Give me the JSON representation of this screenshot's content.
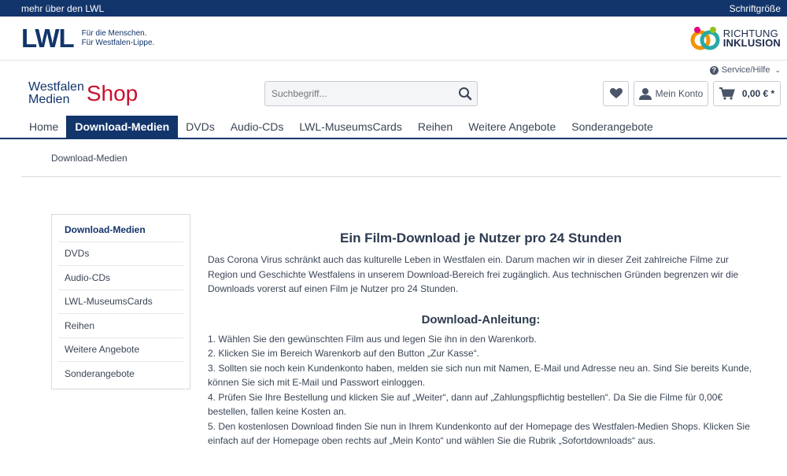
{
  "topbar": {
    "left_link": "mehr über den LWL",
    "font_size_label": "Schriftgröße"
  },
  "brand": {
    "lwl_mark": "LWL",
    "tagline_1": "Für die Menschen.",
    "tagline_2": "Für Westfalen-Lippe.",
    "inklusion_line_1": "RICHTUNG",
    "inklusion_line_2": "INKLUSION"
  },
  "service": {
    "label": "Service/Hilfe"
  },
  "shop": {
    "logo_line_1": "Westfalen",
    "logo_line_2": "Medien",
    "logo_shop": "Shop",
    "search_placeholder": "Suchbegriff...",
    "account_label": "Mein Konto",
    "cart_total": "0,00 € *"
  },
  "nav": {
    "items": [
      "Home",
      "Download-Medien",
      "DVDs",
      "Audio-CDs",
      "LWL-MuseumsCards",
      "Reihen",
      "Weitere Angebote",
      "Sonderangebote"
    ],
    "active": "Download-Medien"
  },
  "breadcrumb": {
    "current": "Download-Medien"
  },
  "sidebar": {
    "items": [
      "Download-Medien",
      "DVDs",
      "Audio-CDs",
      "LWL-MuseumsCards",
      "Reihen",
      "Weitere Angebote",
      "Sonderangebote"
    ]
  },
  "content": {
    "title": "Ein Film-Download je Nutzer pro 24 Stunden",
    "intro": " Das Corona Virus schränkt auch das kulturelle Leben in Westfalen ein. Darum machen wir in dieser Zeit zahlreiche Filme zur Region und Geschichte Westfalens in unserem Download-Bereich frei zugänglich. Aus technischen Gründen begrenzen wir die Downloads vorerst auf einen Film je Nutzer pro 24 Stunden.",
    "subtitle": "Download-Anleitung:",
    "steps": [
      "1. Wählen Sie den gewünschten Film aus und legen Sie ihn in den Warenkorb.",
      "2. Klicken Sie im Bereich Warenkorb auf den Button „Zur Kasse“.",
      "3. Sollten sie noch kein Kundenkonto haben, melden sie sich nun mit Namen, E-Mail und Adresse neu an. Sind Sie bereits Kunde, können Sie sich mit E-Mail und Passwort einloggen.",
      "4. Prüfen Sie Ihre Bestellung und klicken Sie auf „Weiter“, dann auf „Zahlungspflichtig bestellen“. Da Sie die Filme für 0,00€ bestellen, fallen keine Kosten an.",
      "5. Den kostenlosen Download finden Sie nun in Ihrem Kundenkonto auf der Homepage des Westfalen-Medien Shops. Klicken Sie einfach auf der Homepage oben rechts auf „Mein Konto“ und wählen Sie die Rubrik „Sofortdownloads“ aus."
    ]
  },
  "colors": {
    "primary": "#12356b",
    "shop_red": "#c8102e"
  }
}
